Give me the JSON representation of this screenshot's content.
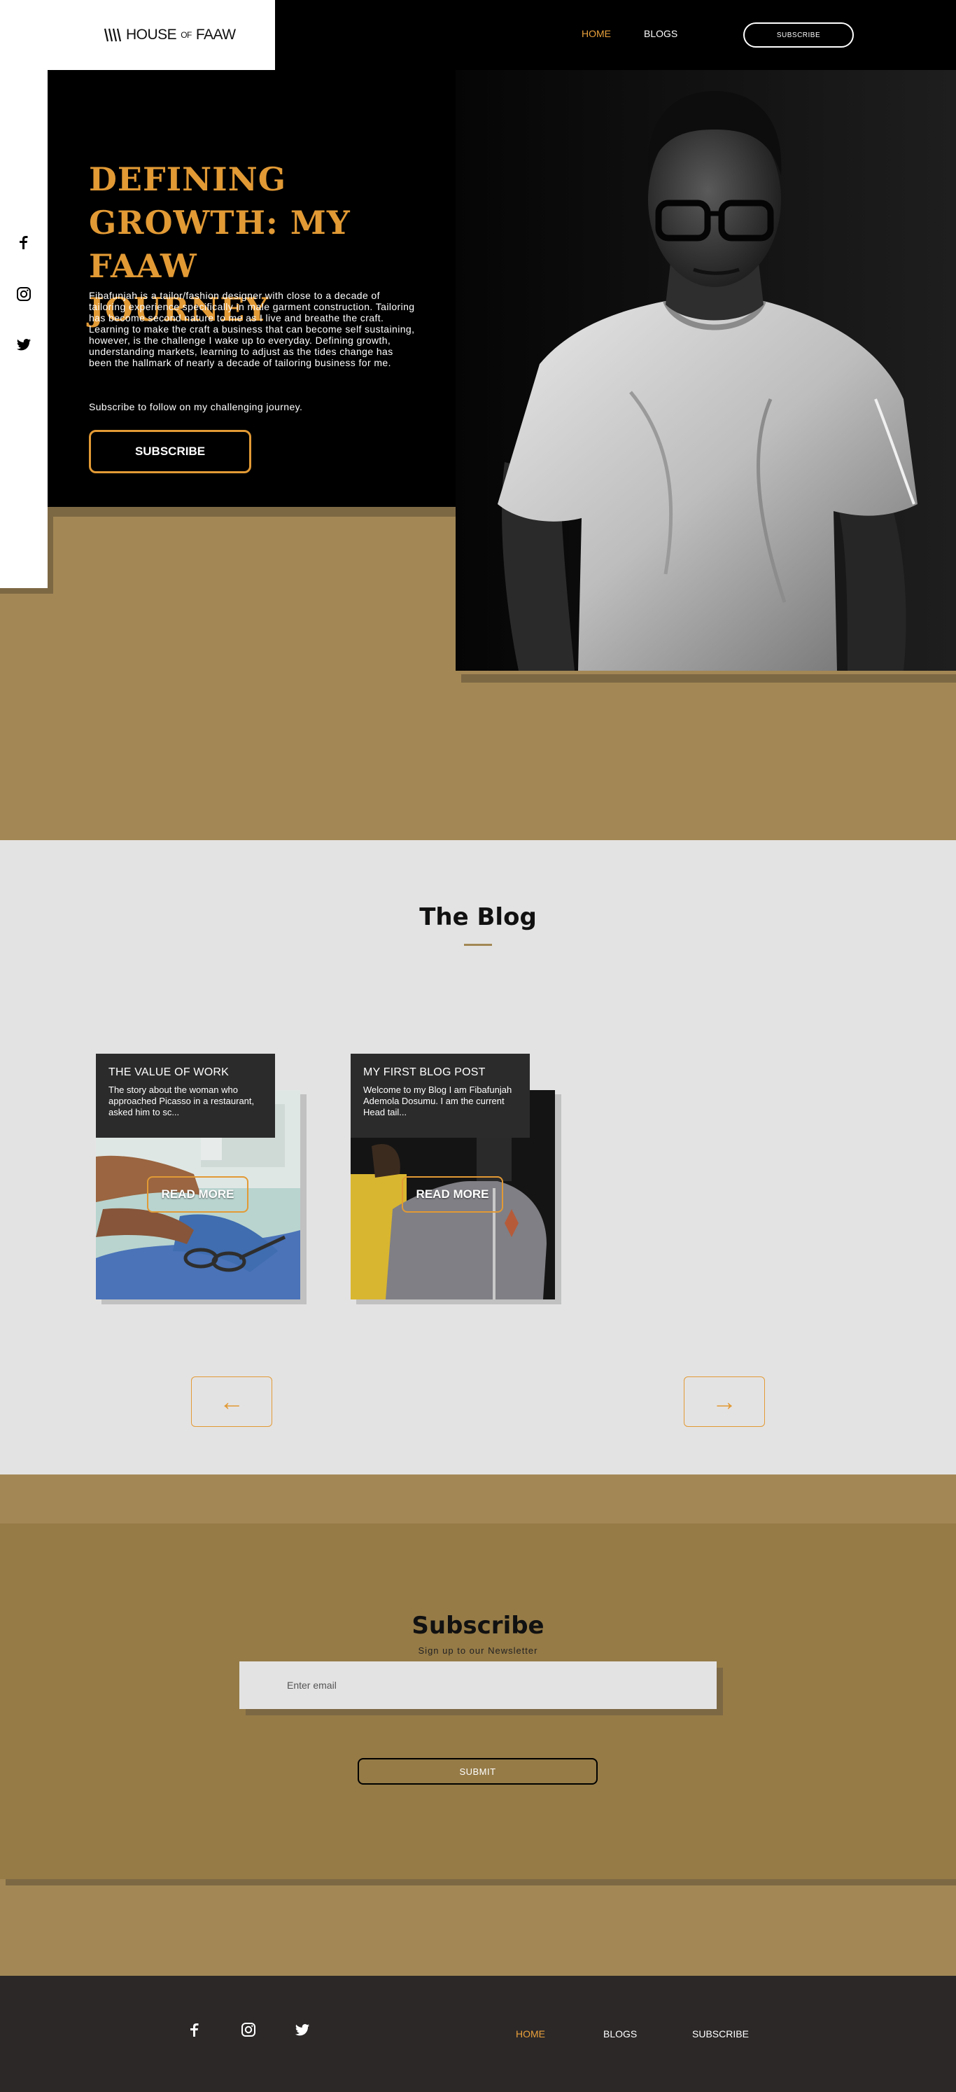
{
  "header": {
    "logo": {
      "main": "HOUSE",
      "of": "OF",
      "brand": "FAAW"
    },
    "nav": [
      {
        "label": "HOME",
        "active": true
      },
      {
        "label": "BLOGS",
        "active": false
      }
    ],
    "subscribe_label": "SUBSCRIBE"
  },
  "sidebar": {
    "icons": [
      "facebook-icon",
      "instagram-icon",
      "twitter-icon"
    ]
  },
  "hero": {
    "title_lines": [
      "DEFINING",
      "GROWTH: MY",
      "FAAW JOURNEY"
    ],
    "description": "Fibafunjah is a tailor/fashion designer with close to a decade of tailoring experience specifically in male garment construction. Tailoring has become second nature to me as I live and breathe the craft. Learning to make the craft a business that can become self sustaining, however, is the challenge I wake up to everyday. Defining growth, understanding markets, learning to adjust as the tides change has been the hallmark of nearly a decade of tailoring business for me.",
    "cta_text": "Subscribe to follow on my challenging journey.",
    "button_label": "SUBSCRIBE"
  },
  "blog": {
    "title": "The Blog",
    "posts": [
      {
        "title": "THE VALUE OF WORK",
        "excerpt": "The story about the woman who approached Picasso in a restaurant, asked him to sc...",
        "button": "READ MORE"
      },
      {
        "title": "MY FIRST BLOG POST",
        "excerpt": "Welcome to my Blog I am Fibafunjah Ademola Dosumu. I am the current Head tail...",
        "button": "READ MORE"
      }
    ],
    "prev_arrow": "←",
    "next_arrow": "→"
  },
  "subscribe": {
    "title": "Subscribe",
    "subtitle": "Sign up to our Newsletter",
    "email_placeholder": "Enter email",
    "submit_label": "SUBMIT"
  },
  "footer": {
    "links": [
      {
        "label": "HOME",
        "active": true
      },
      {
        "label": "BLOGS",
        "active": false
      },
      {
        "label": "SUBSCRIBE",
        "active": false
      }
    ]
  },
  "colors": {
    "accent": "#e29a35",
    "tan": "#a38855",
    "tan_dark": "#967b47",
    "footer": "#2c2828"
  }
}
